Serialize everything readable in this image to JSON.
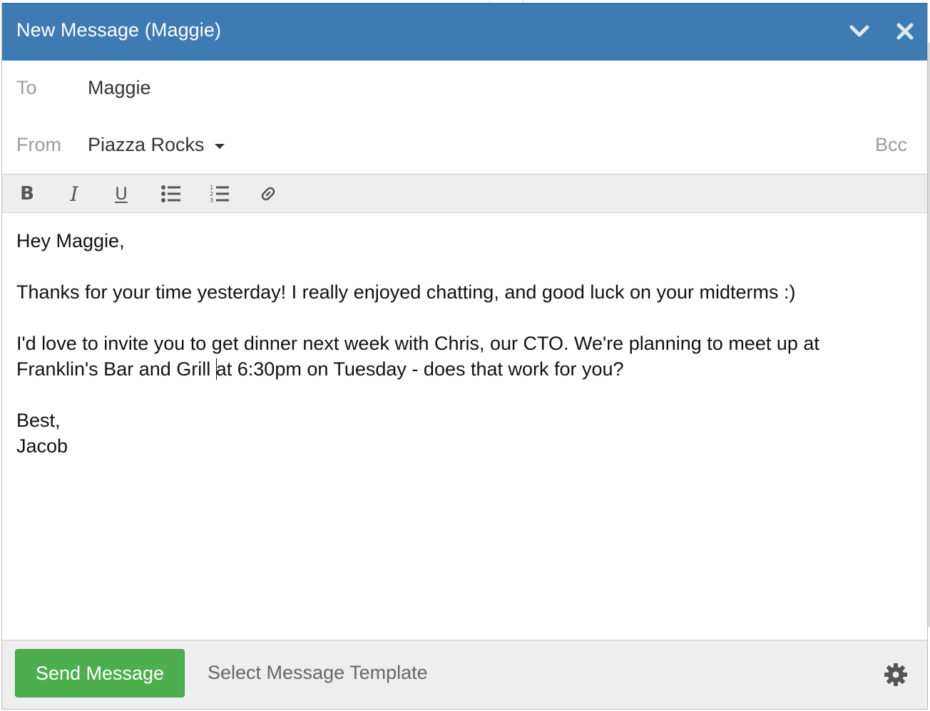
{
  "window": {
    "title": "New Message (Maggie)",
    "minimize_icon": "chevron-down-icon",
    "close_icon": "close-icon",
    "title_bar_color": "#3e7bb2"
  },
  "fields": {
    "to_label": "To",
    "to_value": "Maggie",
    "from_label": "From",
    "from_value": "Piazza Rocks",
    "bcc_label": "Bcc"
  },
  "toolbar": {
    "bold": "B",
    "italic": "I",
    "underline": "U",
    "icons": [
      "bold-icon",
      "italic-icon",
      "underline-icon",
      "bulleted-list-icon",
      "numbered-list-icon",
      "link-icon"
    ]
  },
  "message": {
    "greeting": "Hey Maggie,",
    "line1": "Thanks for your time yesterday! I really enjoyed chatting, and good luck on your midterms :)",
    "line2": "I'd love to invite you to get dinner next week with Chris, our CTO. We're planning to meet up at",
    "line3_before_cursor": "Franklin's Bar and Grill ",
    "line3_after_cursor": "at 6:30pm on Tuesday - does that work for you?",
    "signoff": "Best,",
    "signature": "Jacob"
  },
  "footer": {
    "send_label": "Send Message",
    "template_label": "Select Message Template",
    "settings_icon": "gear-icon",
    "send_color": "#4cae4c"
  }
}
